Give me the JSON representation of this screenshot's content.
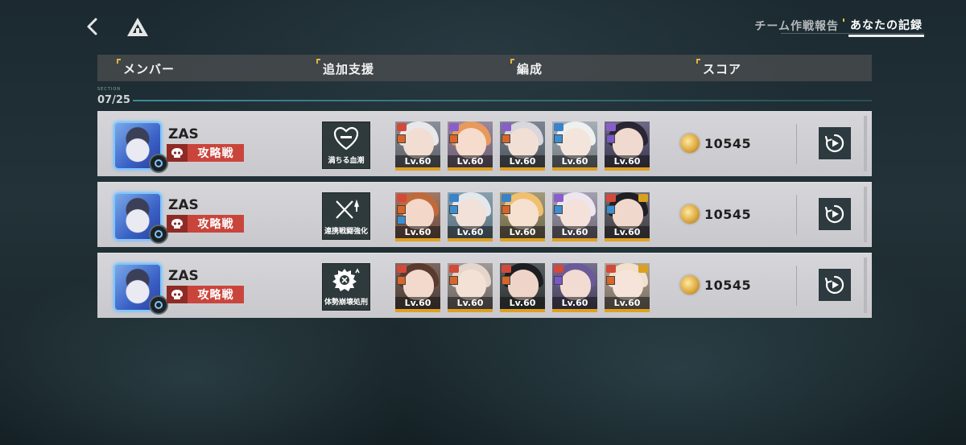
{
  "nav": {
    "back_icon": "chevron-left-icon",
    "home_icon": "triangle-logo-icon"
  },
  "tabs": [
    {
      "label": "チーム作戦報告",
      "active": false
    },
    {
      "label": "あなたの記録",
      "active": true
    }
  ],
  "header": {
    "member": "メンバー",
    "support": "追加支援",
    "formation": "編成",
    "score": "スコア"
  },
  "section": {
    "small_label": "SECTION",
    "date": "07/25"
  },
  "records": [
    {
      "player": "ZAS",
      "mode": "攻略戦",
      "support": "満ちる血潮",
      "units": [
        {
          "level": "Lv.60"
        },
        {
          "level": "Lv.60"
        },
        {
          "level": "Lv.60"
        },
        {
          "level": "Lv.60"
        },
        {
          "level": "Lv.60"
        }
      ],
      "score": "10545"
    },
    {
      "player": "ZAS",
      "mode": "攻略戦",
      "support": "連携戦闘強化",
      "units": [
        {
          "level": "Lv.60"
        },
        {
          "level": "Lv.60"
        },
        {
          "level": "Lv.60"
        },
        {
          "level": "Lv.60"
        },
        {
          "level": "Lv.60"
        }
      ],
      "score": "10545"
    },
    {
      "player": "ZAS",
      "mode": "攻略戦",
      "support": "体勢崩壊処刑",
      "units": [
        {
          "level": "Lv.60"
        },
        {
          "level": "Lv.60"
        },
        {
          "level": "Lv.60"
        },
        {
          "level": "Lv.60"
        },
        {
          "level": "Lv.60"
        }
      ],
      "score": "10545"
    }
  ],
  "colors": {
    "mode_badge": "#c9453c",
    "level_bar": "#e0a020",
    "accent_line": "#3f8a95",
    "replay_button": "#2d3a3f"
  }
}
